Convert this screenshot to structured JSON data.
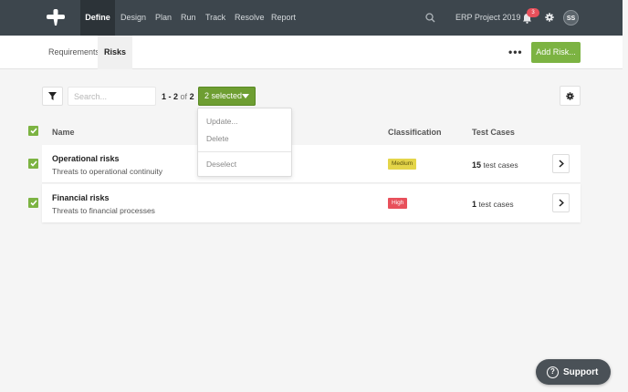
{
  "topbar": {
    "nav": [
      "Define",
      "Design",
      "Plan",
      "Run",
      "Track",
      "Resolve",
      "Report"
    ],
    "active_nav": "Define",
    "project": "ERP Project 2019",
    "notifications_count": "3",
    "avatar_initials": "SS",
    "background_color": "#3d464d"
  },
  "subnav": {
    "tabs": [
      "Requirements",
      "Risks"
    ],
    "active_tab": "Risks",
    "more_label": "•••",
    "add_button": "Add Risk..."
  },
  "toolbar": {
    "search_placeholder": "Search...",
    "pager_range": "1 - 2",
    "pager_of": "of",
    "pager_total": "2",
    "selected_button": "2 selected"
  },
  "dropdown": {
    "items": [
      "Update...",
      "Delete",
      "Deselect"
    ]
  },
  "table": {
    "headers": {
      "name": "Name",
      "classification": "Classification",
      "test_cases": "Test Cases"
    },
    "rows": [
      {
        "title": "Operational risks",
        "subtitle": "Threats to operational continuity",
        "classification": "Medium",
        "tc_count": "15",
        "tc_label": "test cases",
        "checked": true
      },
      {
        "title": "Financial risks",
        "subtitle": "Threats to financial processes",
        "classification": "High",
        "tc_count": "1",
        "tc_label": "test cases",
        "checked": true
      }
    ]
  },
  "support": {
    "label": "Support",
    "icon": "?"
  },
  "colors": {
    "accent": "#7cb342",
    "high": "#e8505b",
    "medium": "#e4d549"
  }
}
